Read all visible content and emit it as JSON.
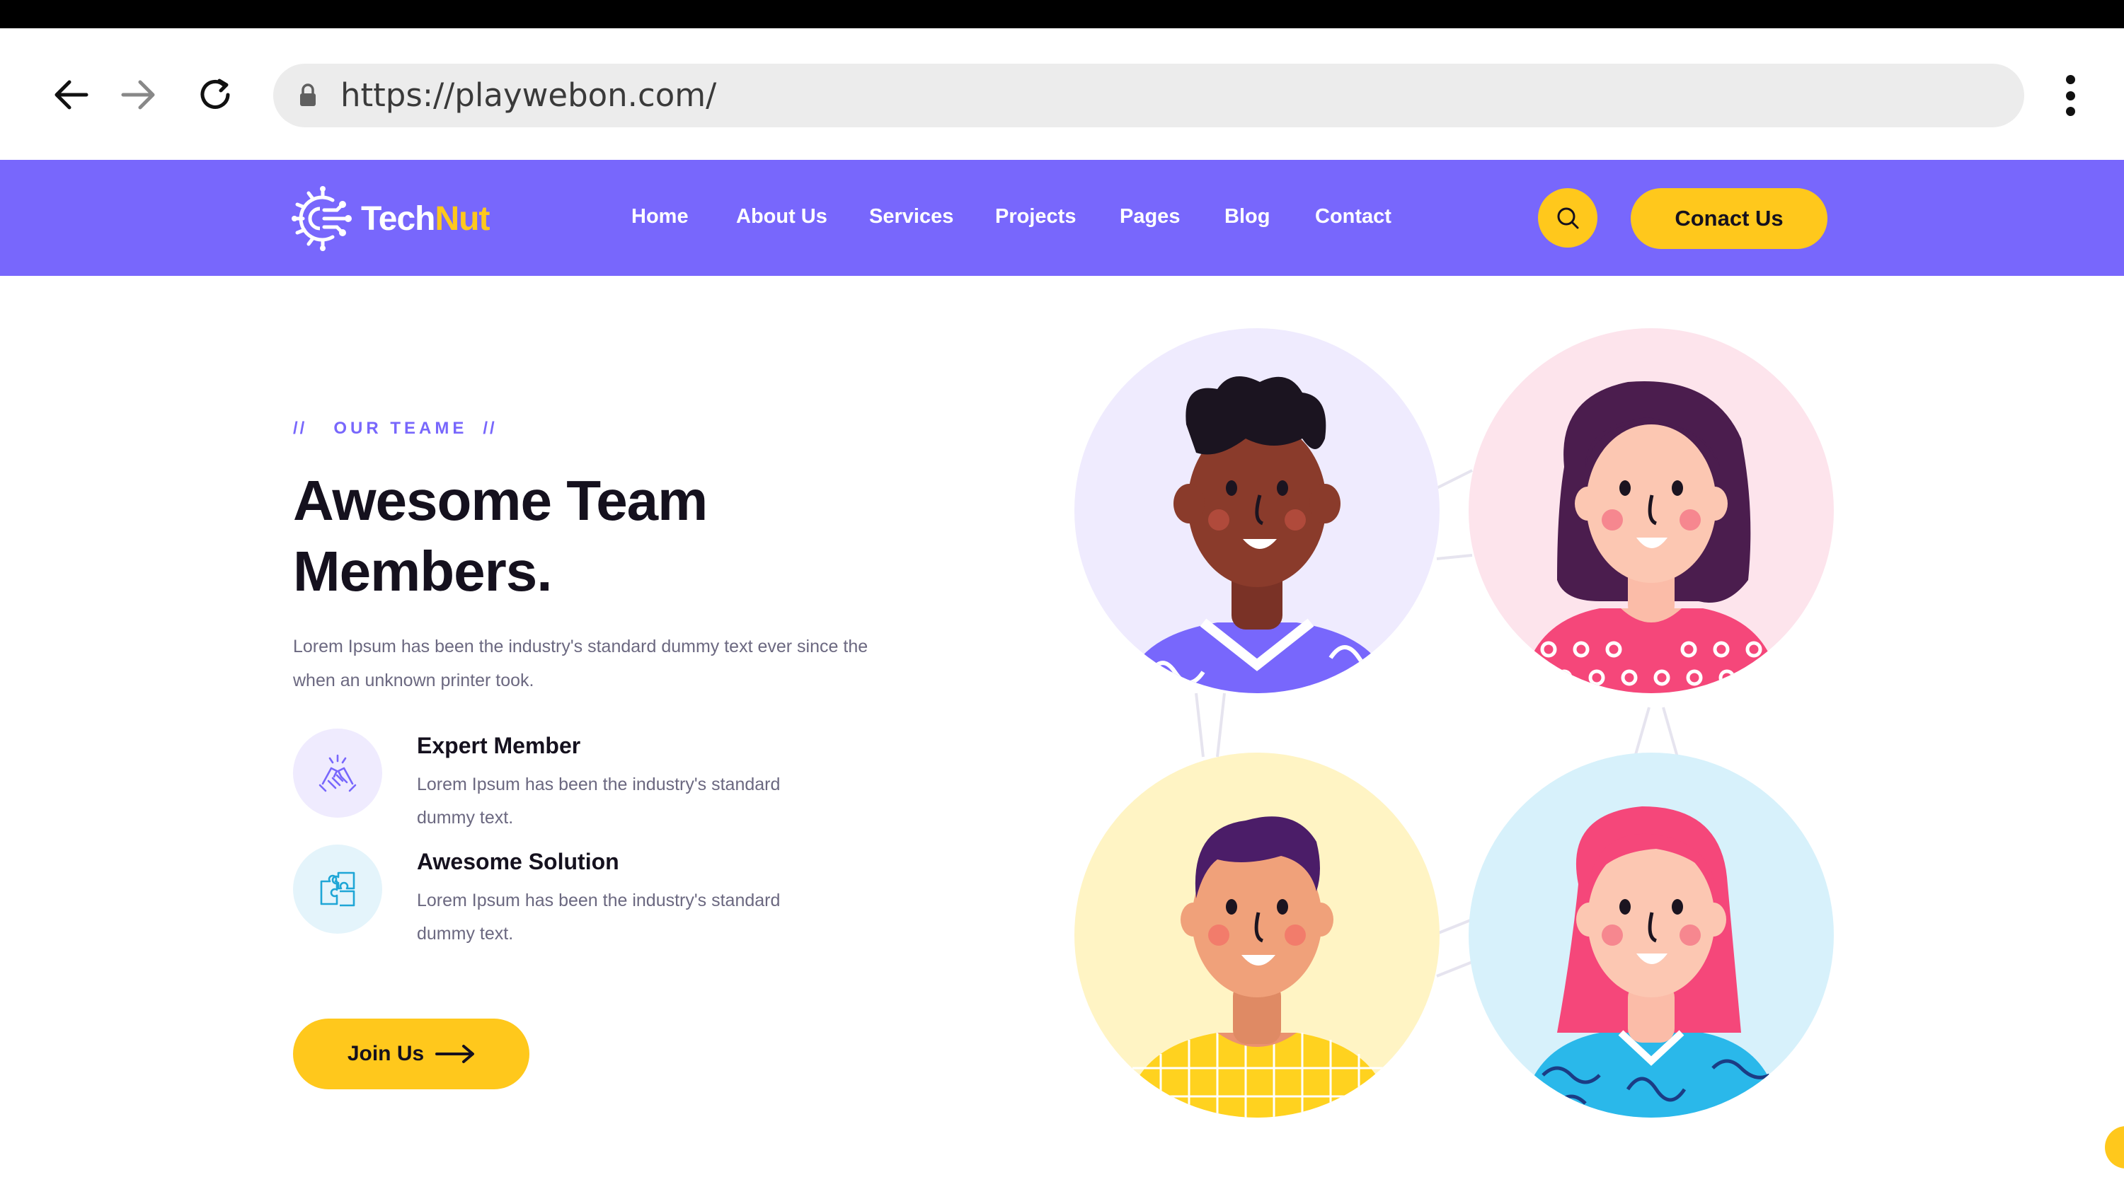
{
  "browser": {
    "url": "https://playwebon.com/",
    "back_icon": "arrow-left-icon",
    "forward_icon": "arrow-right-icon",
    "reload_icon": "reload-icon",
    "lock_icon": "lock-icon",
    "menu_icon": "more-vertical-icon"
  },
  "site": {
    "brand_colors": {
      "primary": "#7867fc",
      "accent": "#ffc81c",
      "dark": "#15111e"
    },
    "logo": {
      "part1": "Tech",
      "part2": "Nut"
    },
    "nav": [
      {
        "label": "Home"
      },
      {
        "label": "About Us"
      },
      {
        "label": "Services"
      },
      {
        "label": "Projects"
      },
      {
        "label": "Pages"
      },
      {
        "label": "Blog"
      },
      {
        "label": "Contact"
      }
    ],
    "search_icon": "search-icon",
    "cta_label": "Conact Us"
  },
  "team": {
    "eyebrow_prefix": "//",
    "eyebrow": "OUR TEAME",
    "eyebrow_suffix": "//",
    "title": "Awesome Team Members.",
    "lead": "Lorem Ipsum has been the industry's standard dummy text ever since the when an unknown printer took.",
    "features": [
      {
        "icon": "handshake-icon",
        "title": "Expert Member",
        "desc": "Lorem Ipsum has been the industry's standard dummy text."
      },
      {
        "icon": "puzzle-icon",
        "title": "Awesome Solution",
        "desc": "Lorem Ipsum has been the industry's standard dummy text."
      }
    ],
    "join_label": "Join Us",
    "join_icon": "arrow-right-icon",
    "avatars": [
      {
        "bg": "#efebfe"
      },
      {
        "bg": "#fde4ec"
      },
      {
        "bg": "#fff4c4"
      },
      {
        "bg": "#d7f1fb"
      }
    ]
  }
}
